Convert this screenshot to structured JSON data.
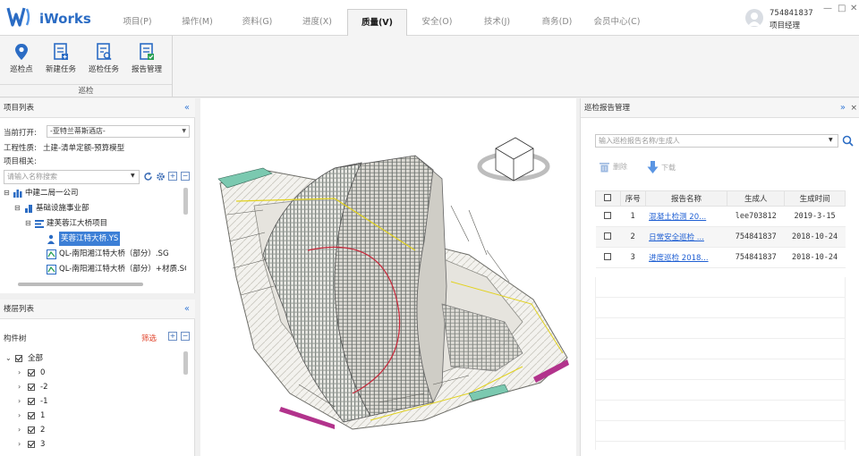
{
  "app": {
    "brand": "iWorks"
  },
  "menu": [
    {
      "label": "项目(P)"
    },
    {
      "label": "操作(M)"
    },
    {
      "label": "资料(G)"
    },
    {
      "label": "进度(X)"
    },
    {
      "label": "质量(V)",
      "active": true
    },
    {
      "label": "安全(O)"
    },
    {
      "label": "技术(J)"
    },
    {
      "label": "商务(D)"
    },
    {
      "label": "会员中心(C)"
    }
  ],
  "user": {
    "id": "754841837",
    "role": "项目经理"
  },
  "window": {
    "minimize": "—",
    "maximize": "□",
    "close": "✕"
  },
  "ribbon": {
    "tools": [
      {
        "label": "巡检点",
        "icon": "location-pin-icon"
      },
      {
        "label": "新建任务",
        "icon": "new-task-icon"
      },
      {
        "label": "巡检任务",
        "icon": "inspection-task-icon"
      },
      {
        "label": "报告管理",
        "icon": "report-manage-icon"
      }
    ],
    "group_label": "巡检"
  },
  "project_panel": {
    "title": "项目列表",
    "collapse": "«",
    "current_label": "当前打开:",
    "current_value": "-亚特兰蒂斯酒店-",
    "nature_label": "工程性质:",
    "nature_value": "土建-清单定额-预算模型",
    "related_label": "项目相关:",
    "search_placeholder": "请输入名称搜索",
    "tree": [
      {
        "label": "中建二局一公司",
        "level": 0
      },
      {
        "label": "基础设施事业部",
        "level": 1
      },
      {
        "label": "建芙蓉江大桥项目",
        "level": 2
      },
      {
        "label": "芙蓉江特大桥.YS",
        "level": 3,
        "selected": true
      },
      {
        "label": "QL-南阳湘江特大桥（部分）.SG",
        "level": 3
      },
      {
        "label": "QL-南阳湘江特大桥（部分）+材质.SG",
        "level": 3
      }
    ]
  },
  "floor_panel": {
    "title": "楼层列表",
    "collapse": "«",
    "tree_label": "构件树",
    "filter_label": "筛选",
    "items": [
      {
        "label": "全部",
        "expanded": true
      },
      {
        "label": "0"
      },
      {
        "label": "-2"
      },
      {
        "label": "-1"
      },
      {
        "label": "1"
      },
      {
        "label": "2"
      },
      {
        "label": "3"
      }
    ]
  },
  "report_panel": {
    "title": "巡检报告管理",
    "collapse": "»",
    "close": "×",
    "search_placeholder": "输入巡检报告名称/生成人",
    "delete_label": "删除",
    "download_label": "下载",
    "columns": [
      "序号",
      "报告名称",
      "生成人",
      "生成时间"
    ],
    "rows": [
      {
        "no": "1",
        "name": "混凝土检测 20...",
        "creator": "lee703812",
        "time": "2019-3-15"
      },
      {
        "no": "2",
        "name": "日常安全巡检 ...",
        "creator": "754841837",
        "time": "2018-10-24"
      },
      {
        "no": "3",
        "name": "进度巡检 2018...",
        "creator": "754841837",
        "time": "2018-10-24"
      }
    ]
  },
  "colors": {
    "accent": "#2b6cc4",
    "selection": "#3c7fd6",
    "filter": "#e0422a",
    "link": "#1f5fd3"
  }
}
